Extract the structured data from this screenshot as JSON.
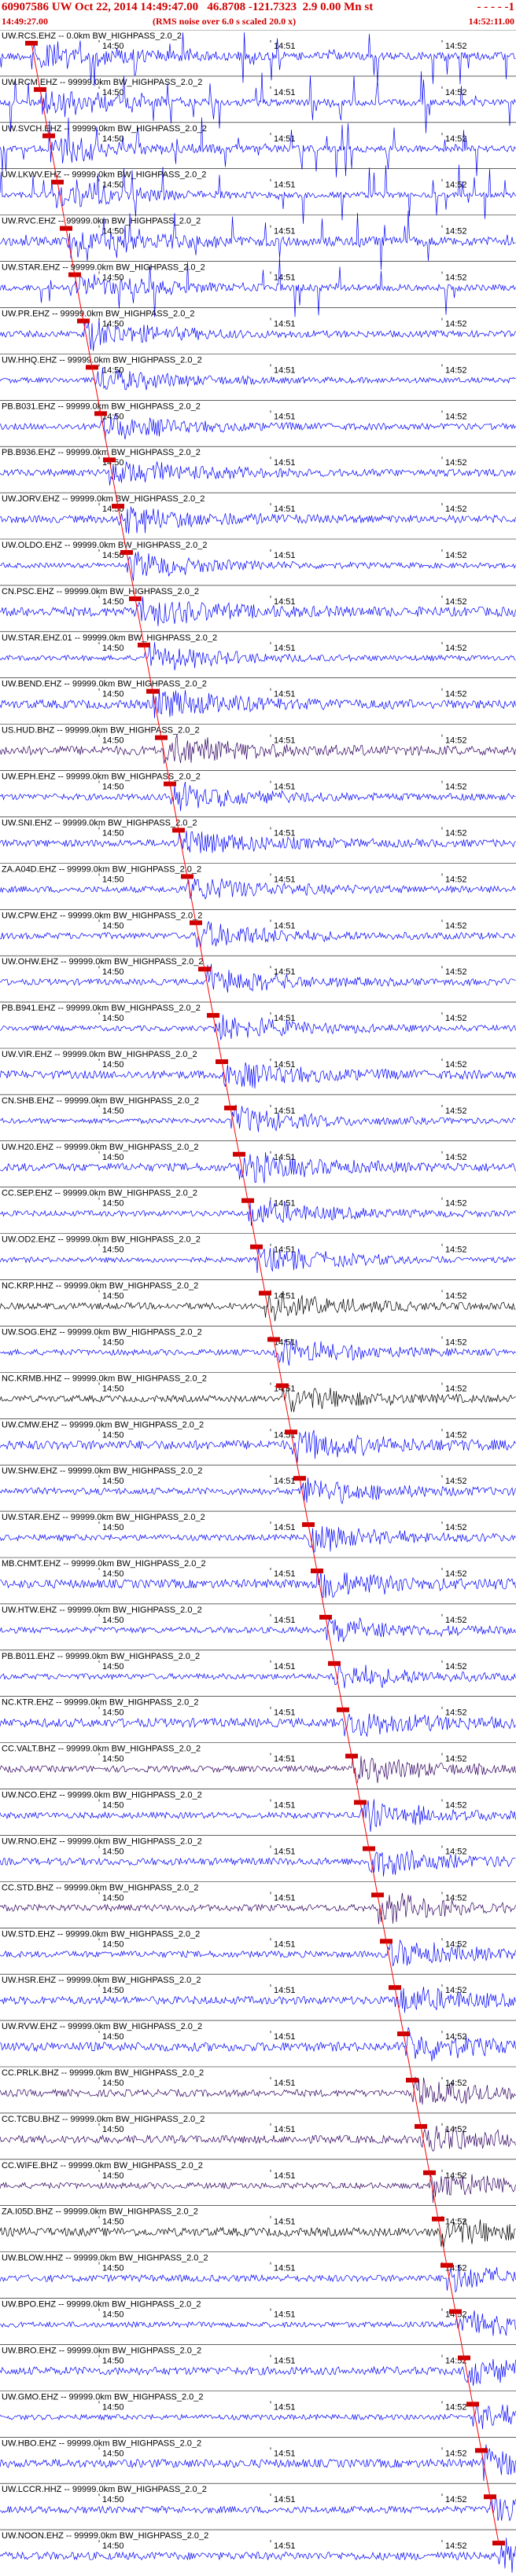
{
  "header": {
    "title": "60907586 UW Oct 22, 2014 14:49:47.00   46.8708 -121.7323  2.9 0.00 Mn st",
    "trailer": "- - - - -1",
    "start_time": "14:49:27.00",
    "note": "(RMS noise over 6.0 s scaled 20.0 x)",
    "end_time": "14:52:11.00"
  },
  "colors": {
    "header_text": "#d00000",
    "trace_blue": "#0000ff",
    "trace_black": "#000000",
    "trace_purple": "#300060",
    "pick_marker": "#cc0000",
    "moveout_line": "#ff0000",
    "grid_line": "#000000"
  },
  "chart_data": {
    "type": "seismogram",
    "time_axis": {
      "start": "14:49:27.00",
      "end": "14:52:11.00",
      "tick_labels": [
        "14:50",
        "14:51",
        "14:52"
      ]
    },
    "traces": [
      {
        "label": "UW.RCS.EHZ -- 0.0km BW_HIGHPASS_2.0_2",
        "color": "blue"
      },
      {
        "label": "UW.RCM.EHZ -- 99999.0km BW_HIGHPASS_2.0_2",
        "color": "blue"
      },
      {
        "label": "UW.SVCH.EHZ -- 99999.0km BW_HIGHPASS_2.0_2",
        "color": "blue"
      },
      {
        "label": "UW.LKWV.EHZ -- 99999.0km BW_HIGHPASS_2.0_2",
        "color": "blue"
      },
      {
        "label": "UW.RVC.EHZ -- 99999.0km BW_HIGHPASS_2.0_2",
        "color": "blue"
      },
      {
        "label": "UW.STAR.EHZ -- 99999.0km BW_HIGHPASS_2.0_2",
        "color": "blue"
      },
      {
        "label": "UW.PR.EHZ -- 99999.0km BW_HIGHPASS_2.0_2",
        "color": "blue"
      },
      {
        "label": "UW.HHQ.EHZ -- 99999.0km BW_HIGHPASS_2.0_2",
        "color": "blue"
      },
      {
        "label": "PB.B031.EHZ -- 99999.0km BW_HIGHPASS_2.0_2",
        "color": "blue"
      },
      {
        "label": "PB.B936.EHZ -- 99999.0km BW_HIGHPASS_2.0_2",
        "color": "blue"
      },
      {
        "label": "UW.JORV.EHZ -- 99999.0km BW_HIGHPASS_2.0_2",
        "color": "blue"
      },
      {
        "label": "UW.OLDO.EHZ -- 99999.0km BW_HIGHPASS_2.0_2",
        "color": "blue"
      },
      {
        "label": "CN.PSC.EHZ -- 99999.0km BW_HIGHPASS_2.0_2",
        "color": "blue"
      },
      {
        "label": "UW.STAR.EHZ.01 -- 99999.0km BW_HIGHPASS_2.0_2",
        "color": "blue"
      },
      {
        "label": "UW.BEND.EHZ -- 99999.0km BW_HIGHPASS_2.0_2",
        "color": "blue"
      },
      {
        "label": "US.HUD.BHZ -- 99999.0km BW_HIGHPASS_2.0_2",
        "color": "purple"
      },
      {
        "label": "UW.EPH.EHZ -- 99999.0km BW_HIGHPASS_2.0_2",
        "color": "blue"
      },
      {
        "label": "UW.SNI.EHZ -- 99999.0km BW_HIGHPASS_2.0_2",
        "color": "blue"
      },
      {
        "label": "ZA.A04D.EHZ -- 99999.0km BW_HIGHPASS_2.0_2",
        "color": "blue"
      },
      {
        "label": "UW.CPW.EHZ -- 99999.0km BW_HIGHPASS_2.0_2",
        "color": "blue"
      },
      {
        "label": "UW.OHW.EHZ -- 99999.0km BW_HIGHPASS_2.0_2",
        "color": "blue"
      },
      {
        "label": "PB.B941.EHZ -- 99999.0km BW_HIGHPASS_2.0_2",
        "color": "blue"
      },
      {
        "label": "UW.VIR.EHZ -- 99999.0km BW_HIGHPASS_2.0_2",
        "color": "blue"
      },
      {
        "label": "CN.SHB.EHZ -- 99999.0km BW_HIGHPASS_2.0_2",
        "color": "blue"
      },
      {
        "label": "UW.H20.EHZ -- 99999.0km BW_HIGHPASS_2.0_2",
        "color": "blue"
      },
      {
        "label": "CC.SEP.EHZ -- 99999.0km BW_HIGHPASS_2.0_2",
        "color": "blue"
      },
      {
        "label": "UW.OD2.EHZ -- 99999.0km BW_HIGHPASS_2.0_2",
        "color": "blue"
      },
      {
        "label": "NC.KRP.HHZ -- 99999.0km BW_HIGHPASS_2.0_2",
        "color": "black"
      },
      {
        "label": "UW.SOG.EHZ -- 99999.0km BW_HIGHPASS_2.0_2",
        "color": "blue"
      },
      {
        "label": "NC.KRMB.HHZ -- 99999.0km BW_HIGHPASS_2.0_2",
        "color": "black"
      },
      {
        "label": "UW.CMW.EHZ -- 99999.0km BW_HIGHPASS_2.0_2",
        "color": "blue"
      },
      {
        "label": "UW.SHW.EHZ -- 99999.0km BW_HIGHPASS_2.0_2",
        "color": "blue"
      },
      {
        "label": "UW.STAR.EHZ -- 99999.0km BW_HIGHPASS_2.0_2",
        "color": "blue"
      },
      {
        "label": "MB.CHMT.EHZ -- 99999.0km BW_HIGHPASS_2.0_2",
        "color": "blue"
      },
      {
        "label": "UW.HTW.EHZ -- 99999.0km BW_HIGHPASS_2.0_2",
        "color": "blue"
      },
      {
        "label": "PB.B011.EHZ -- 99999.0km BW_HIGHPASS_2.0_2",
        "color": "blue"
      },
      {
        "label": "NC.KTR.EHZ -- 99999.0km BW_HIGHPASS_2.0_2",
        "color": "blue"
      },
      {
        "label": "CC.VALT.BHZ -- 99999.0km BW_HIGHPASS_2.0_2",
        "color": "purple"
      },
      {
        "label": "UW.NCO.EHZ -- 99999.0km BW_HIGHPASS_2.0_2",
        "color": "blue"
      },
      {
        "label": "UW.RNO.EHZ -- 99999.0km BW_HIGHPASS_2.0_2",
        "color": "blue"
      },
      {
        "label": "CC.STD.BHZ -- 99999.0km BW_HIGHPASS_2.0_2",
        "color": "purple"
      },
      {
        "label": "UW.STD.EHZ -- 99999.0km BW_HIGHPASS_2.0_2",
        "color": "blue"
      },
      {
        "label": "UW.HSR.EHZ -- 99999.0km BW_HIGHPASS_2.0_2",
        "color": "blue"
      },
      {
        "label": "UW.RVW.EHZ -- 99999.0km BW_HIGHPASS_2.0_2",
        "color": "blue"
      },
      {
        "label": "CC.PRLK.BHZ -- 99999.0km BW_HIGHPASS_2.0_2",
        "color": "purple"
      },
      {
        "label": "CC.TCBU.BHZ -- 99999.0km BW_HIGHPASS_2.0_2",
        "color": "purple"
      },
      {
        "label": "CC.WIFE.BHZ -- 99999.0km BW_HIGHPASS_2.0_2",
        "color": "purple"
      },
      {
        "label": "ZA.I05D.BHZ -- 99999.0km BW_HIGHPASS_2.0_2",
        "color": "black"
      },
      {
        "label": "UW.BLOW.HHZ -- 99999.0km BW_HIGHPASS_2.0_2",
        "color": "blue"
      },
      {
        "label": "UW.BPO.EHZ -- 99999.0km BW_HIGHPASS_2.0_2",
        "color": "blue"
      },
      {
        "label": "UW.BRO.EHZ -- 99999.0km BW_HIGHPASS_2.0_2",
        "color": "blue"
      },
      {
        "label": "UW.GMO.EHZ -- 99999.0km BW_HIGHPASS_2.0_2",
        "color": "blue"
      },
      {
        "label": "UW.HBO.EHZ -- 99999.0km BW_HIGHPASS_2.0_2",
        "color": "blue"
      },
      {
        "label": "UW.LCCR.HHZ -- 99999.0km BW_HIGHPASS_2.0_2",
        "color": "blue"
      },
      {
        "label": "UW.NOON.EHZ -- 99999.0km BW_HIGHPASS_2.0_2",
        "color": "blue"
      }
    ]
  }
}
